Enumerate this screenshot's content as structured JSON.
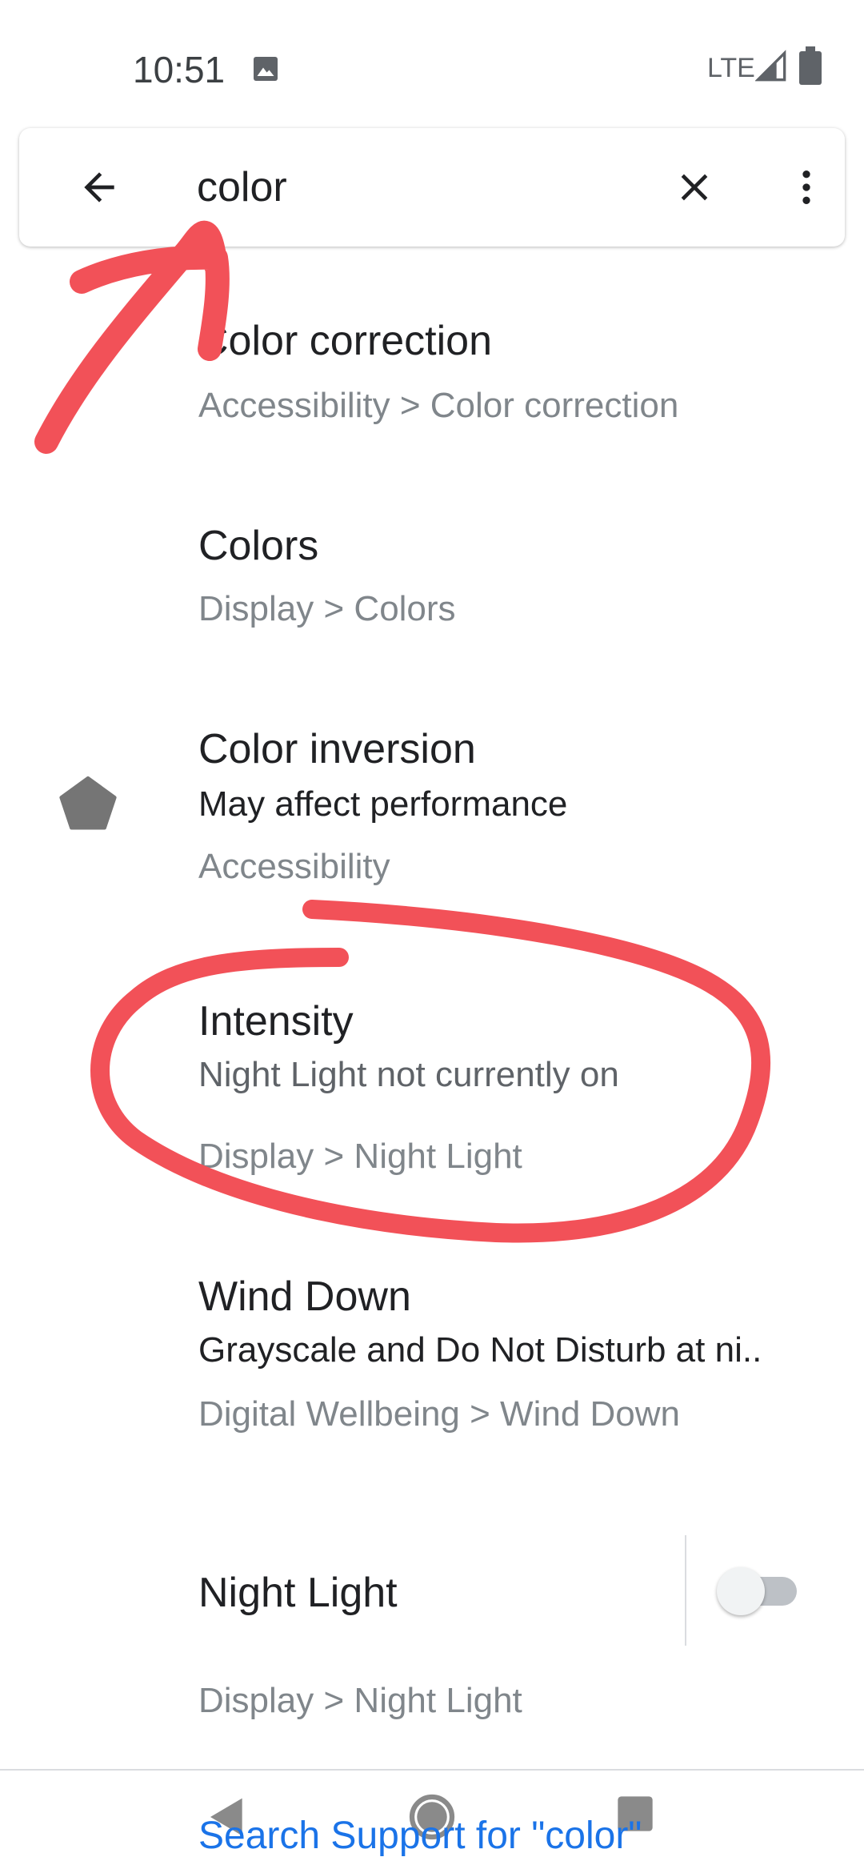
{
  "status_bar": {
    "time": "10:51",
    "network": "LTE",
    "icons": [
      "image-icon",
      "signal-icon",
      "battery-icon"
    ]
  },
  "search": {
    "query": "color",
    "icons": [
      "back-arrow-icon",
      "clear-icon",
      "more-vert-icon"
    ]
  },
  "results": [
    {
      "title": "Color correction",
      "breadcrumb": "Accessibility > Color correction"
    },
    {
      "title": "Colors",
      "breadcrumb": "Display > Colors"
    },
    {
      "title": "Color inversion",
      "summary": "May affect performance",
      "breadcrumb": "Accessibility",
      "icon": "pentagon-icon"
    },
    {
      "title": "Intensity",
      "summary": "Night Light not currently on",
      "breadcrumb": "Display > Night Light"
    },
    {
      "title": "Wind Down",
      "summary": "Grayscale and Do Not Disturb at ni..",
      "breadcrumb": "Digital Wellbeing > Wind Down"
    },
    {
      "title": "Night Light",
      "breadcrumb": "Display > Night Light",
      "toggle_on": false
    }
  ],
  "footer": {
    "support_link": "Search Support for \"color\""
  },
  "colors": {
    "accent_link": "#1a73e8",
    "annotation": "#f25158",
    "title_text": "#202124",
    "secondary_text": "#80868b"
  }
}
